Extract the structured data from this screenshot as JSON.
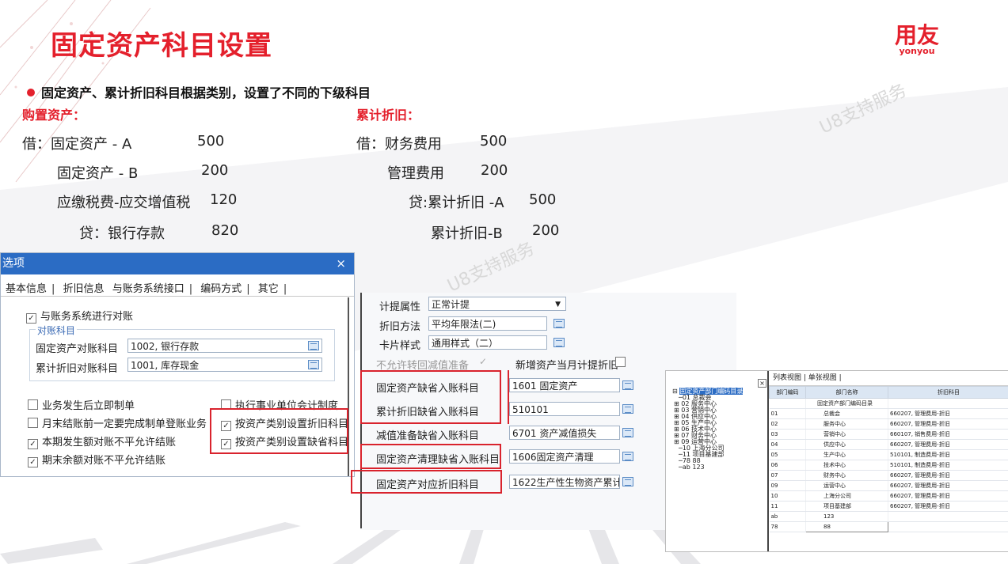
{
  "slide": {
    "title": "固定资产科目设置",
    "logo_cn": "用友",
    "logo_en": "yonyou",
    "bullet": "固定资产、累计折旧科目根据类别，设置了不同的下级科目",
    "watermark": "U8支持服务",
    "accent_color": "#e4202c"
  },
  "purchase": {
    "heading": "购置资产：",
    "lines": [
      {
        "text": "借：固定资产 - A",
        "amount": "500"
      },
      {
        "text": "固定资产 - B",
        "amount": "200"
      },
      {
        "text": "应缴税费-应交增值税",
        "amount": "120"
      },
      {
        "text": "贷：银行存款",
        "amount": "820"
      }
    ]
  },
  "depreciation": {
    "heading": "累计折旧：",
    "lines": [
      {
        "text": "借：财务费用",
        "amount": "500"
      },
      {
        "text": "管理费用",
        "amount": "200"
      },
      {
        "text": "贷:累计折旧 -A",
        "amount": "500"
      },
      {
        "text": "累计折旧-B",
        "amount": "200"
      }
    ]
  },
  "dialog_options": {
    "title": "选项",
    "close": "×",
    "tabs": [
      "基本信息",
      "折旧信息",
      "与账务系统接口",
      "编码方式",
      "其它"
    ],
    "active_tab": "与账务系统接口",
    "reconcile_check": "与账务系统进行对账",
    "group_label": "对账科目",
    "fa_account_label": "固定资产对账科目",
    "fa_account_value": "1002, 银行存款",
    "dep_account_label": "累计折旧对账科目",
    "dep_account_value": "1001, 库存现金",
    "checks_left": [
      {
        "label": "业务发生后立即制单",
        "checked": false
      },
      {
        "label": "月末结账前一定要完成制单登账业务",
        "checked": false
      },
      {
        "label": "本期发生额对账不平允许结账",
        "checked": true
      },
      {
        "label": "期末余额对账不平允许结账",
        "checked": true
      }
    ],
    "checks_right": [
      {
        "label": "执行事业单位会计制度",
        "checked": false
      },
      {
        "label": "按资产类别设置折旧科目",
        "checked": true
      },
      {
        "label": "按资产类别设置缺省科目",
        "checked": true
      }
    ]
  },
  "dialog_category": {
    "accrual_label": "计提属性",
    "accrual_value": "正常计提",
    "method_label": "折旧方法",
    "method_value": "平均年限法(二)",
    "card_label": "卡片样式",
    "card_value": "通用样式（二）",
    "no_impairment_label": "不允许转回减值准备",
    "new_asset_label": "新增资产当月计提折旧",
    "fields": [
      {
        "label": "固定资产缺省入账科目",
        "value": "1601 固定资产"
      },
      {
        "label": "累计折旧缺省入账科目",
        "value": "510101"
      },
      {
        "label": "减值准备缺省入账科目",
        "value": "6701 资产减值损失"
      },
      {
        "label": "固定资产清理缺省入账科目",
        "value": "1606固定资产清理"
      },
      {
        "label": "固定资产对应折旧科目",
        "value": "1622生产性生物资产累计"
      }
    ]
  },
  "dialog_dept": {
    "tree_root": "固定资产部门编码目录",
    "tree_items": [
      "01 总裁会",
      "02 服务中心",
      "03 营销中心",
      "04 供应中心",
      "05 生产中心",
      "06 技术中心",
      "07 财务中心",
      "09 运营中心",
      "10 上海分公司",
      "11 项目基建部",
      "78 88",
      "ab 123"
    ],
    "view_tabs": [
      "列表视图",
      "单张视图"
    ],
    "headers": [
      "部门编码",
      "部门名称",
      "折旧科目"
    ],
    "root_row": "固定资产部门编码目录",
    "rows": [
      {
        "code": "01",
        "name": "总裁会",
        "account": "660207, 管理费用-折旧"
      },
      {
        "code": "02",
        "name": "服务中心",
        "account": "660207, 管理费用-折旧"
      },
      {
        "code": "03",
        "name": "营销中心",
        "account": "660107, 销售费用-折旧"
      },
      {
        "code": "04",
        "name": "供应中心",
        "account": "660207, 管理费用-折旧"
      },
      {
        "code": "05",
        "name": "生产中心",
        "account": "510101, 制造费用-折旧"
      },
      {
        "code": "06",
        "name": "技术中心",
        "account": "510101, 制造费用-折旧"
      },
      {
        "code": "07",
        "name": "财务中心",
        "account": "660207, 管理费用-折旧"
      },
      {
        "code": "09",
        "name": "运营中心",
        "account": "660207, 管理费用-折旧"
      },
      {
        "code": "10",
        "name": "上海分公司",
        "account": "660207, 管理费用-折旧"
      },
      {
        "code": "11",
        "name": "项目基建部",
        "account": "660207, 管理费用-折旧"
      },
      {
        "code": "ab",
        "name": "123",
        "account": ""
      },
      {
        "code": "78",
        "name": "88",
        "account": ""
      }
    ]
  }
}
